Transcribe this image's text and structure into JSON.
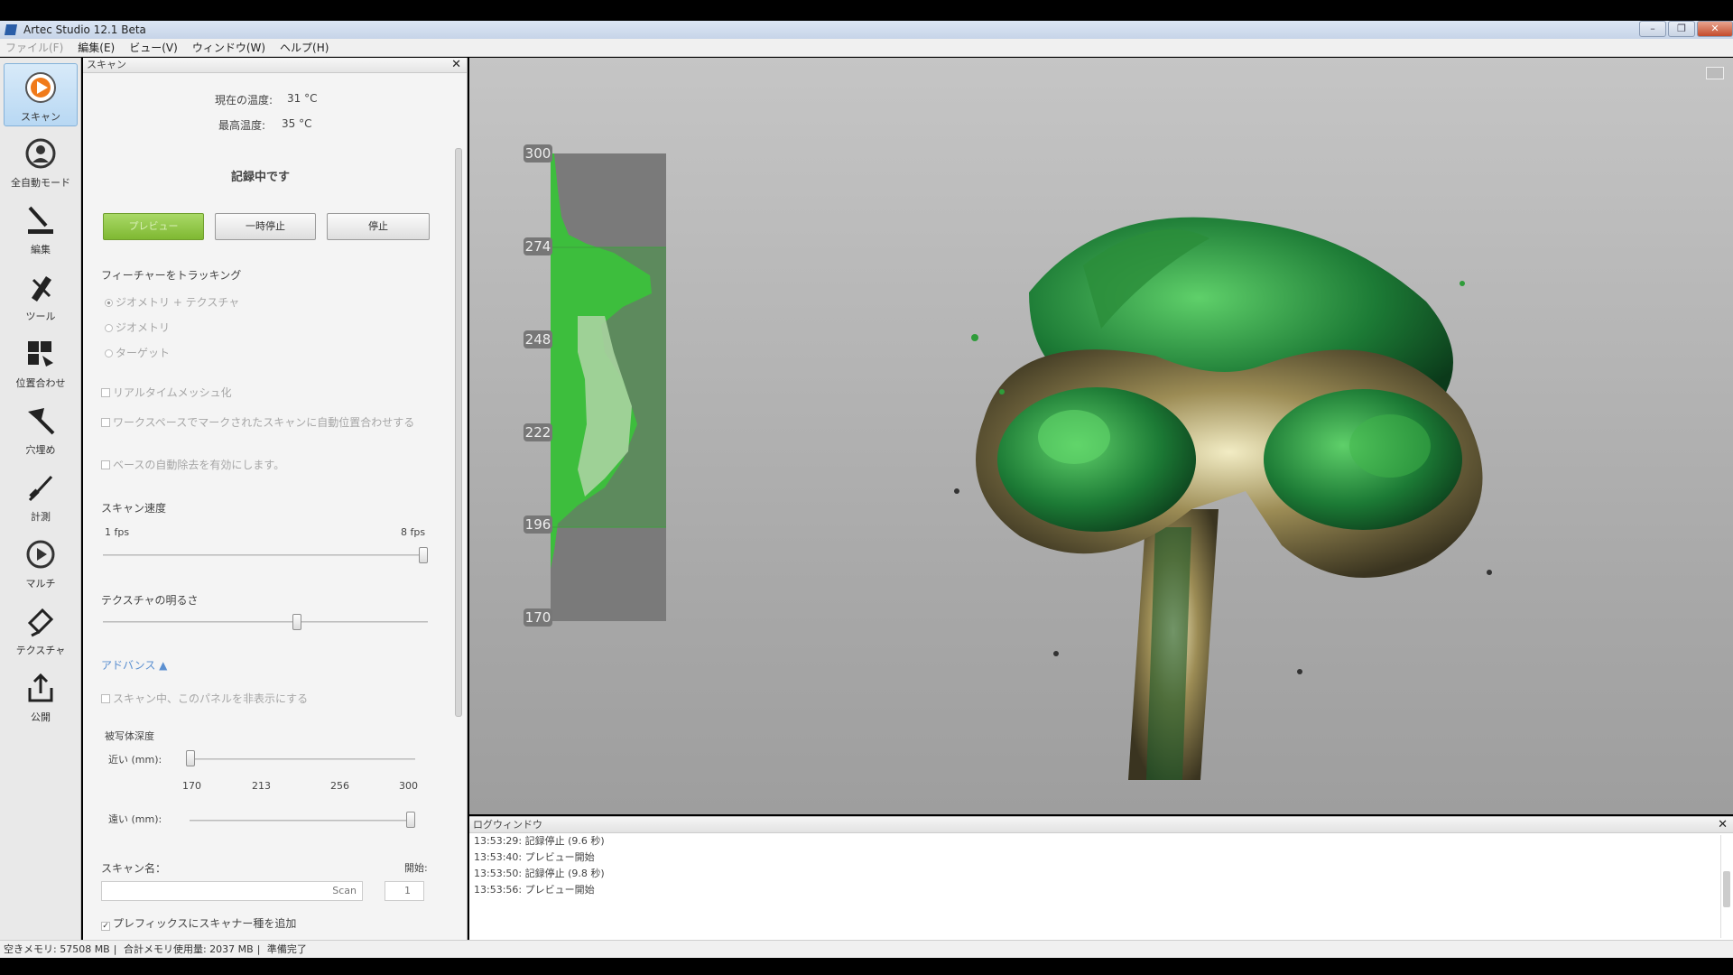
{
  "window": {
    "title": "Artec Studio 12.1 Beta"
  },
  "menu": [
    {
      "label": "ファイル(F)",
      "enabled": false
    },
    {
      "label": "編集(E)",
      "enabled": true
    },
    {
      "label": "ビュー(V)",
      "enabled": true
    },
    {
      "label": "ウィンドウ(W)",
      "enabled": true
    },
    {
      "label": "ヘルプ(H)",
      "enabled": true
    }
  ],
  "toolbar": [
    {
      "label": "スキャン",
      "icon": "scan-play-icon",
      "active": true
    },
    {
      "label": "全自動モード",
      "icon": "autopilot-icon",
      "active": false
    },
    {
      "label": "編集",
      "icon": "eraser-icon",
      "active": false
    },
    {
      "label": "ツール",
      "icon": "tools-icon",
      "active": false
    },
    {
      "label": "位置合わせ",
      "icon": "align-icon",
      "active": false
    },
    {
      "label": "穴埋め",
      "icon": "fix-holes-icon",
      "active": false
    },
    {
      "label": "計測",
      "icon": "measure-icon",
      "active": false
    },
    {
      "label": "マルチ",
      "icon": "multi-icon",
      "active": false
    },
    {
      "label": "テクスチャ",
      "icon": "texture-icon",
      "active": false
    },
    {
      "label": "公開",
      "icon": "publish-icon",
      "active": false
    }
  ],
  "scan_panel": {
    "title": "スキャン",
    "temp_current_label": "現在の温度:",
    "temp_current_value": "31 °C",
    "temp_max_label": "最高温度:",
    "temp_max_value": "35 °C",
    "status": "記録中です",
    "buttons": {
      "preview": "プレビュー",
      "pause": "一時停止",
      "stop": "停止"
    },
    "tracking_heading": "フィーチャーをトラッキング",
    "tracking_options": [
      "ジオメトリ + テクスチャ",
      "ジオメトリ",
      "ターゲット"
    ],
    "checkbox_realtime": "リアルタイムメッシュ化",
    "checkbox_autoalign": "ワークスペースでマークされたスキャンに自動位置合わせする",
    "checkbox_base": "ベースの自動除去を有効にします。",
    "speed_heading": "スキャン速度",
    "speed_min": "1 fps",
    "speed_max": "8 fps",
    "speed_value_fraction": 1.0,
    "brightness_heading": "テクスチャの明るさ",
    "brightness_value_fraction": 0.6,
    "advanced_label": "アドバンス ▲",
    "checkbox_hide_panel": "スキャン中、このパネルを非表示にする",
    "depth_heading": "被写体深度",
    "near_label": "近い (mm):",
    "far_label": "遠い (mm):",
    "depth_ticks": [
      "170",
      "213",
      "256",
      "300"
    ],
    "scan_name_label": "スキャン名：",
    "scan_name_value": "Scan",
    "start_label": "開始:",
    "start_value": "1",
    "checkbox_prefix": "プレフィックスにスキャナー種を追加"
  },
  "histogram": {
    "ticks": [
      "300",
      "274",
      "248",
      "222",
      "196",
      "170"
    ]
  },
  "log": {
    "title": "ログウィンドウ",
    "lines": [
      "13:53:29: 記録停止 (9.6 秒)",
      "13:53:40: プレビュー開始",
      "13:53:50: 記録停止 (9.8 秒)",
      "13:53:56: プレビュー開始"
    ]
  },
  "statusbar": {
    "free_memory": "空きメモリ: 57508 MB",
    "used_memory": "合計メモリ使用量: 2037 MB",
    "ready": "準備完了"
  },
  "colors": {
    "accent_green": "#7fb832",
    "viewport_bg": "#b4b4b4"
  }
}
